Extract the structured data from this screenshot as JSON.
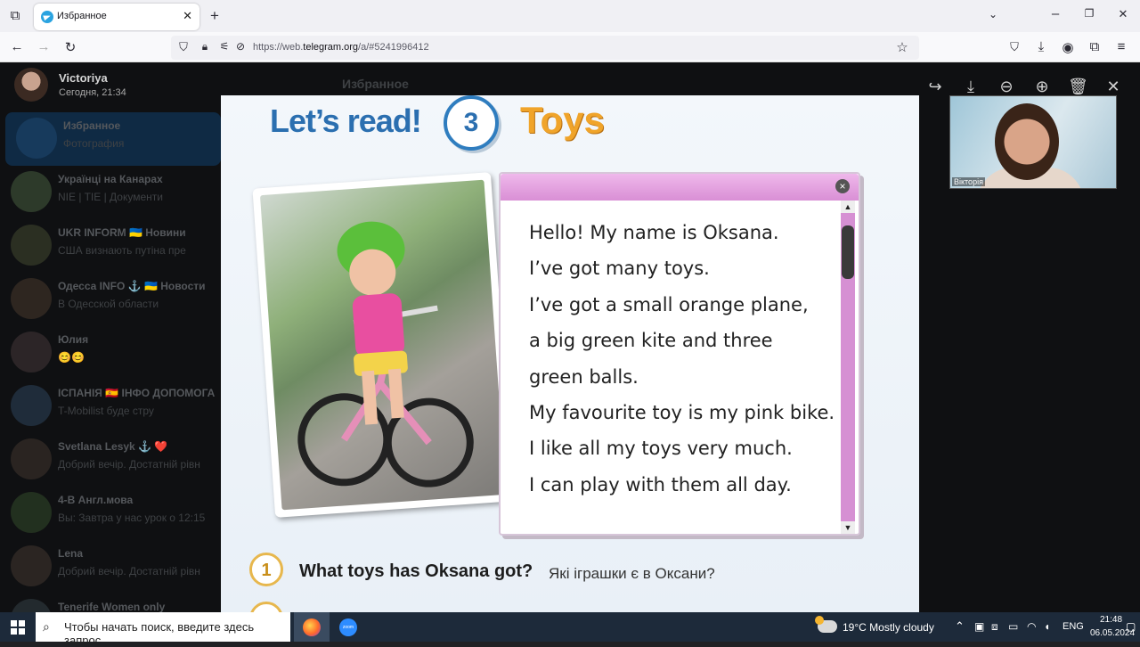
{
  "browser": {
    "tab_title": "Избранное",
    "url_prefix": "https://web.",
    "url_domain": "telegram.org",
    "url_suffix": "/a/#5241996412"
  },
  "telegram": {
    "viewer_user": "Victoriya",
    "viewer_time": "Сегодня, 21:34",
    "bg_chat_title": "Избранное",
    "chats": [
      {
        "name": "Избранное",
        "preview": "Фотография"
      },
      {
        "name": "Українці на Канарах",
        "preview": "NIE | TIE | Документи"
      },
      {
        "name": "UKR INFORM 🇺🇦 Новини",
        "preview": "США визнають путіна пре"
      },
      {
        "name": "Одесса INFO ⚓ 🇺🇦 Новости",
        "preview": "В Одесской области"
      },
      {
        "name": "Юлия",
        "preview": "😊😊"
      },
      {
        "name": "ІСПАНІЯ 🇪🇸 ІНФО ДОПОМОГА",
        "preview": "T-Mobilist буде стру"
      },
      {
        "name": "Svetlana Lesyk ⚓ ❤️",
        "preview": "Добрий вечір. Достатній рівн"
      },
      {
        "name": "4-В Англ.мова",
        "preview": "Вы: Завтра у нас урок о 12:15"
      },
      {
        "name": "Lena",
        "preview": "Добрий вечір. Достатній рівн"
      },
      {
        "name": "Tenerife Women only",
        "preview": ""
      }
    ]
  },
  "lesson": {
    "heading": "Let’s read!",
    "number": "3",
    "topic": "Toys",
    "text_lines": [
      "Hello! My name is Oksana.",
      "I’ve got many toys.",
      "I’ve got a small orange plane,",
      "a big green kite and three",
      "green balls.",
      "My favourite toy is my pink bike.",
      "I like all my toys very much.",
      "I can play with them all day."
    ],
    "q1_number": "1",
    "q1_text": "What toys has Oksana got?",
    "q1_translation": "Які іграшки є в Оксани?"
  },
  "video": {
    "label": "Вікторія"
  },
  "taskbar": {
    "search_placeholder": "Чтобы начать поиск, введите здесь запрос",
    "weather": "19°C  Mostly cloudy",
    "lang": "ENG",
    "time": "21:48",
    "date": "06.05.2024",
    "zoom_label": "zoom"
  }
}
